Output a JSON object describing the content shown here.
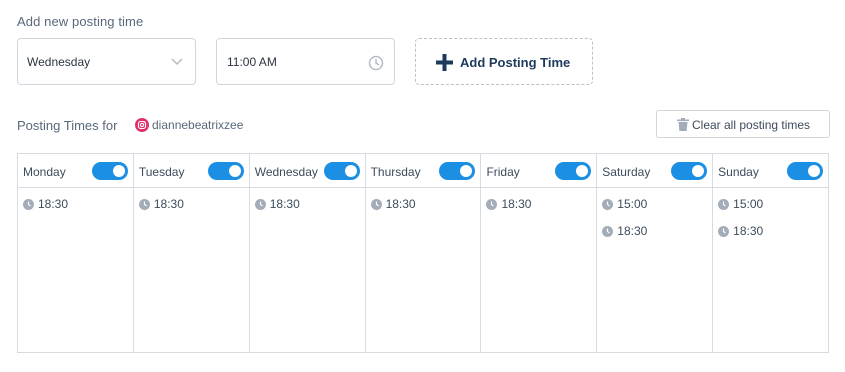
{
  "form": {
    "title": "Add new posting time",
    "day_value": "Wednesday",
    "time_value": "11:00 AM",
    "add_label": "Add Posting Time"
  },
  "posting_times": {
    "label": "Posting Times for",
    "account": "diannebeatrixzee",
    "clear_label": "Clear all posting times"
  },
  "colors": {
    "accent": "#1a8fe3",
    "add_button_text": "#1d3a5c",
    "instagram": "#e1306c"
  },
  "days": [
    {
      "name": "Monday",
      "enabled": true,
      "times": [
        "18:30"
      ]
    },
    {
      "name": "Tuesday",
      "enabled": true,
      "times": [
        "18:30"
      ]
    },
    {
      "name": "Wednesday",
      "enabled": true,
      "times": [
        "18:30"
      ]
    },
    {
      "name": "Thursday",
      "enabled": true,
      "times": [
        "18:30"
      ]
    },
    {
      "name": "Friday",
      "enabled": true,
      "times": [
        "18:30"
      ]
    },
    {
      "name": "Saturday",
      "enabled": true,
      "times": [
        "15:00",
        "18:30"
      ]
    },
    {
      "name": "Sunday",
      "enabled": true,
      "times": [
        "15:00",
        "18:30"
      ]
    }
  ]
}
